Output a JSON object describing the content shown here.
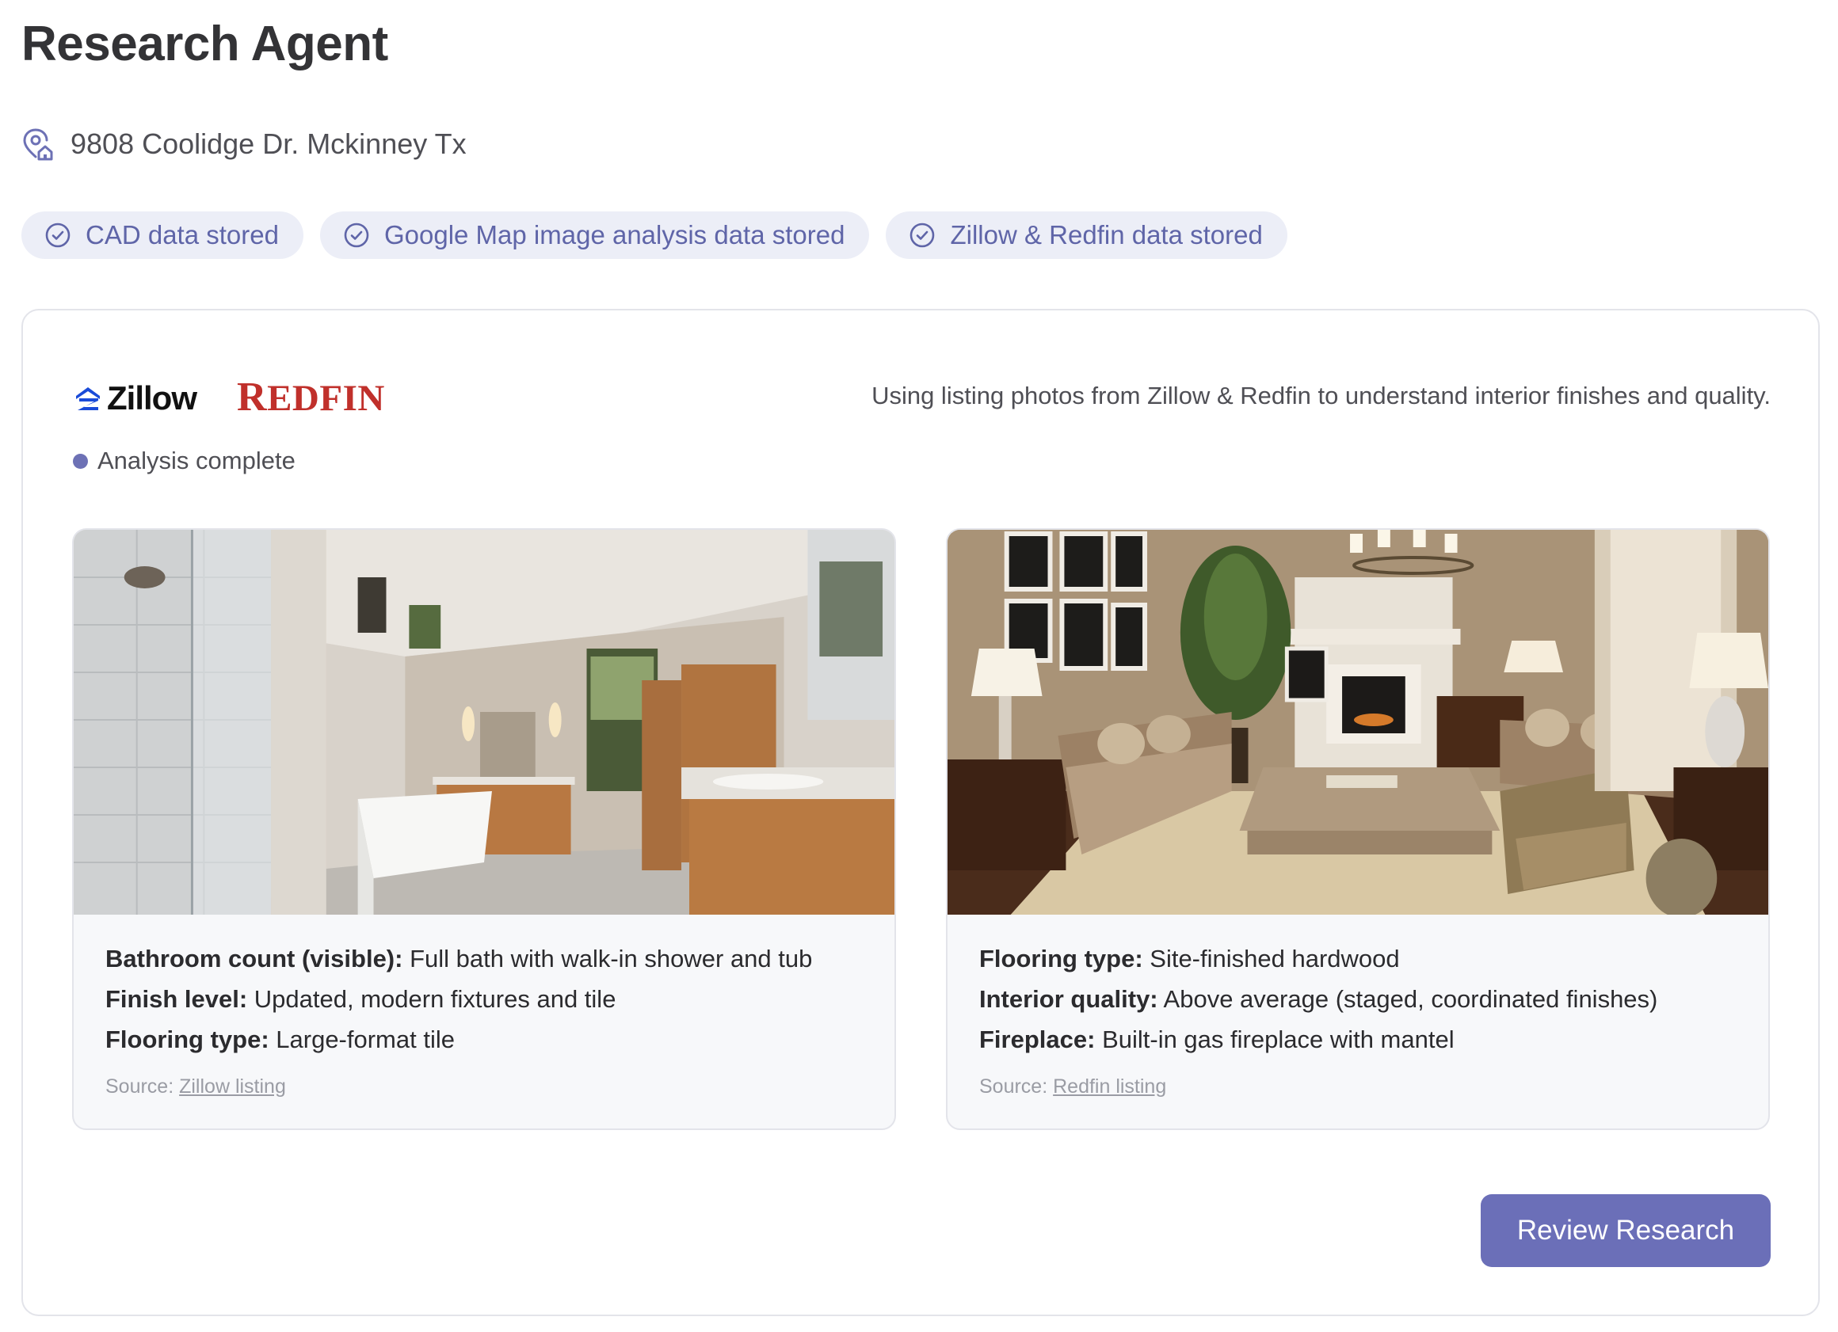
{
  "header": {
    "title": "Research Agent",
    "address": "9808 Coolidge Dr. Mckinney Tx",
    "address_icon": "map-pin-home-icon"
  },
  "badges": [
    {
      "label": "CAD data stored",
      "icon": "check-circle-icon"
    },
    {
      "label": "Google Map image analysis data stored",
      "icon": "check-circle-icon"
    },
    {
      "label": "Zillow & Redfin data stored",
      "icon": "check-circle-icon"
    }
  ],
  "panel": {
    "logos": {
      "zillow": "Zillow",
      "redfin_first": "R",
      "redfin_rest": "EDFIN"
    },
    "description": "Using listing photos from Zillow & Redfin to understand interior finishes and quality.",
    "status": "Analysis complete",
    "cards": [
      {
        "photo": "bathroom-photo",
        "facts": [
          {
            "key": "Bathroom count (visible):",
            "value": " Full bath with walk-in shower and tub"
          },
          {
            "key": "Finish level:",
            "value": " Updated, modern fixtures and tile"
          },
          {
            "key": "Flooring type:",
            "value": " Large-format tile"
          }
        ],
        "source_label": "Source: ",
        "source_link": "Zillow listing"
      },
      {
        "photo": "living-room-photo",
        "facts": [
          {
            "key": "Flooring type:",
            "value": " Site-finished hardwood"
          },
          {
            "key": "Interior quality:",
            "value": " Above average (staged, coordinated finishes)"
          },
          {
            "key": "Fireplace:",
            "value": " Built-in gas fireplace with mantel"
          }
        ],
        "source_label": "Source: ",
        "source_link": "Redfin listing"
      }
    ],
    "review_button": "Review Research"
  },
  "colors": {
    "accent": "#6b6fb8",
    "badge_bg": "#eceef7",
    "badge_text": "#5f65a8",
    "redfin_red": "#c0302b",
    "zillow_blue": "#1a4bd8"
  }
}
